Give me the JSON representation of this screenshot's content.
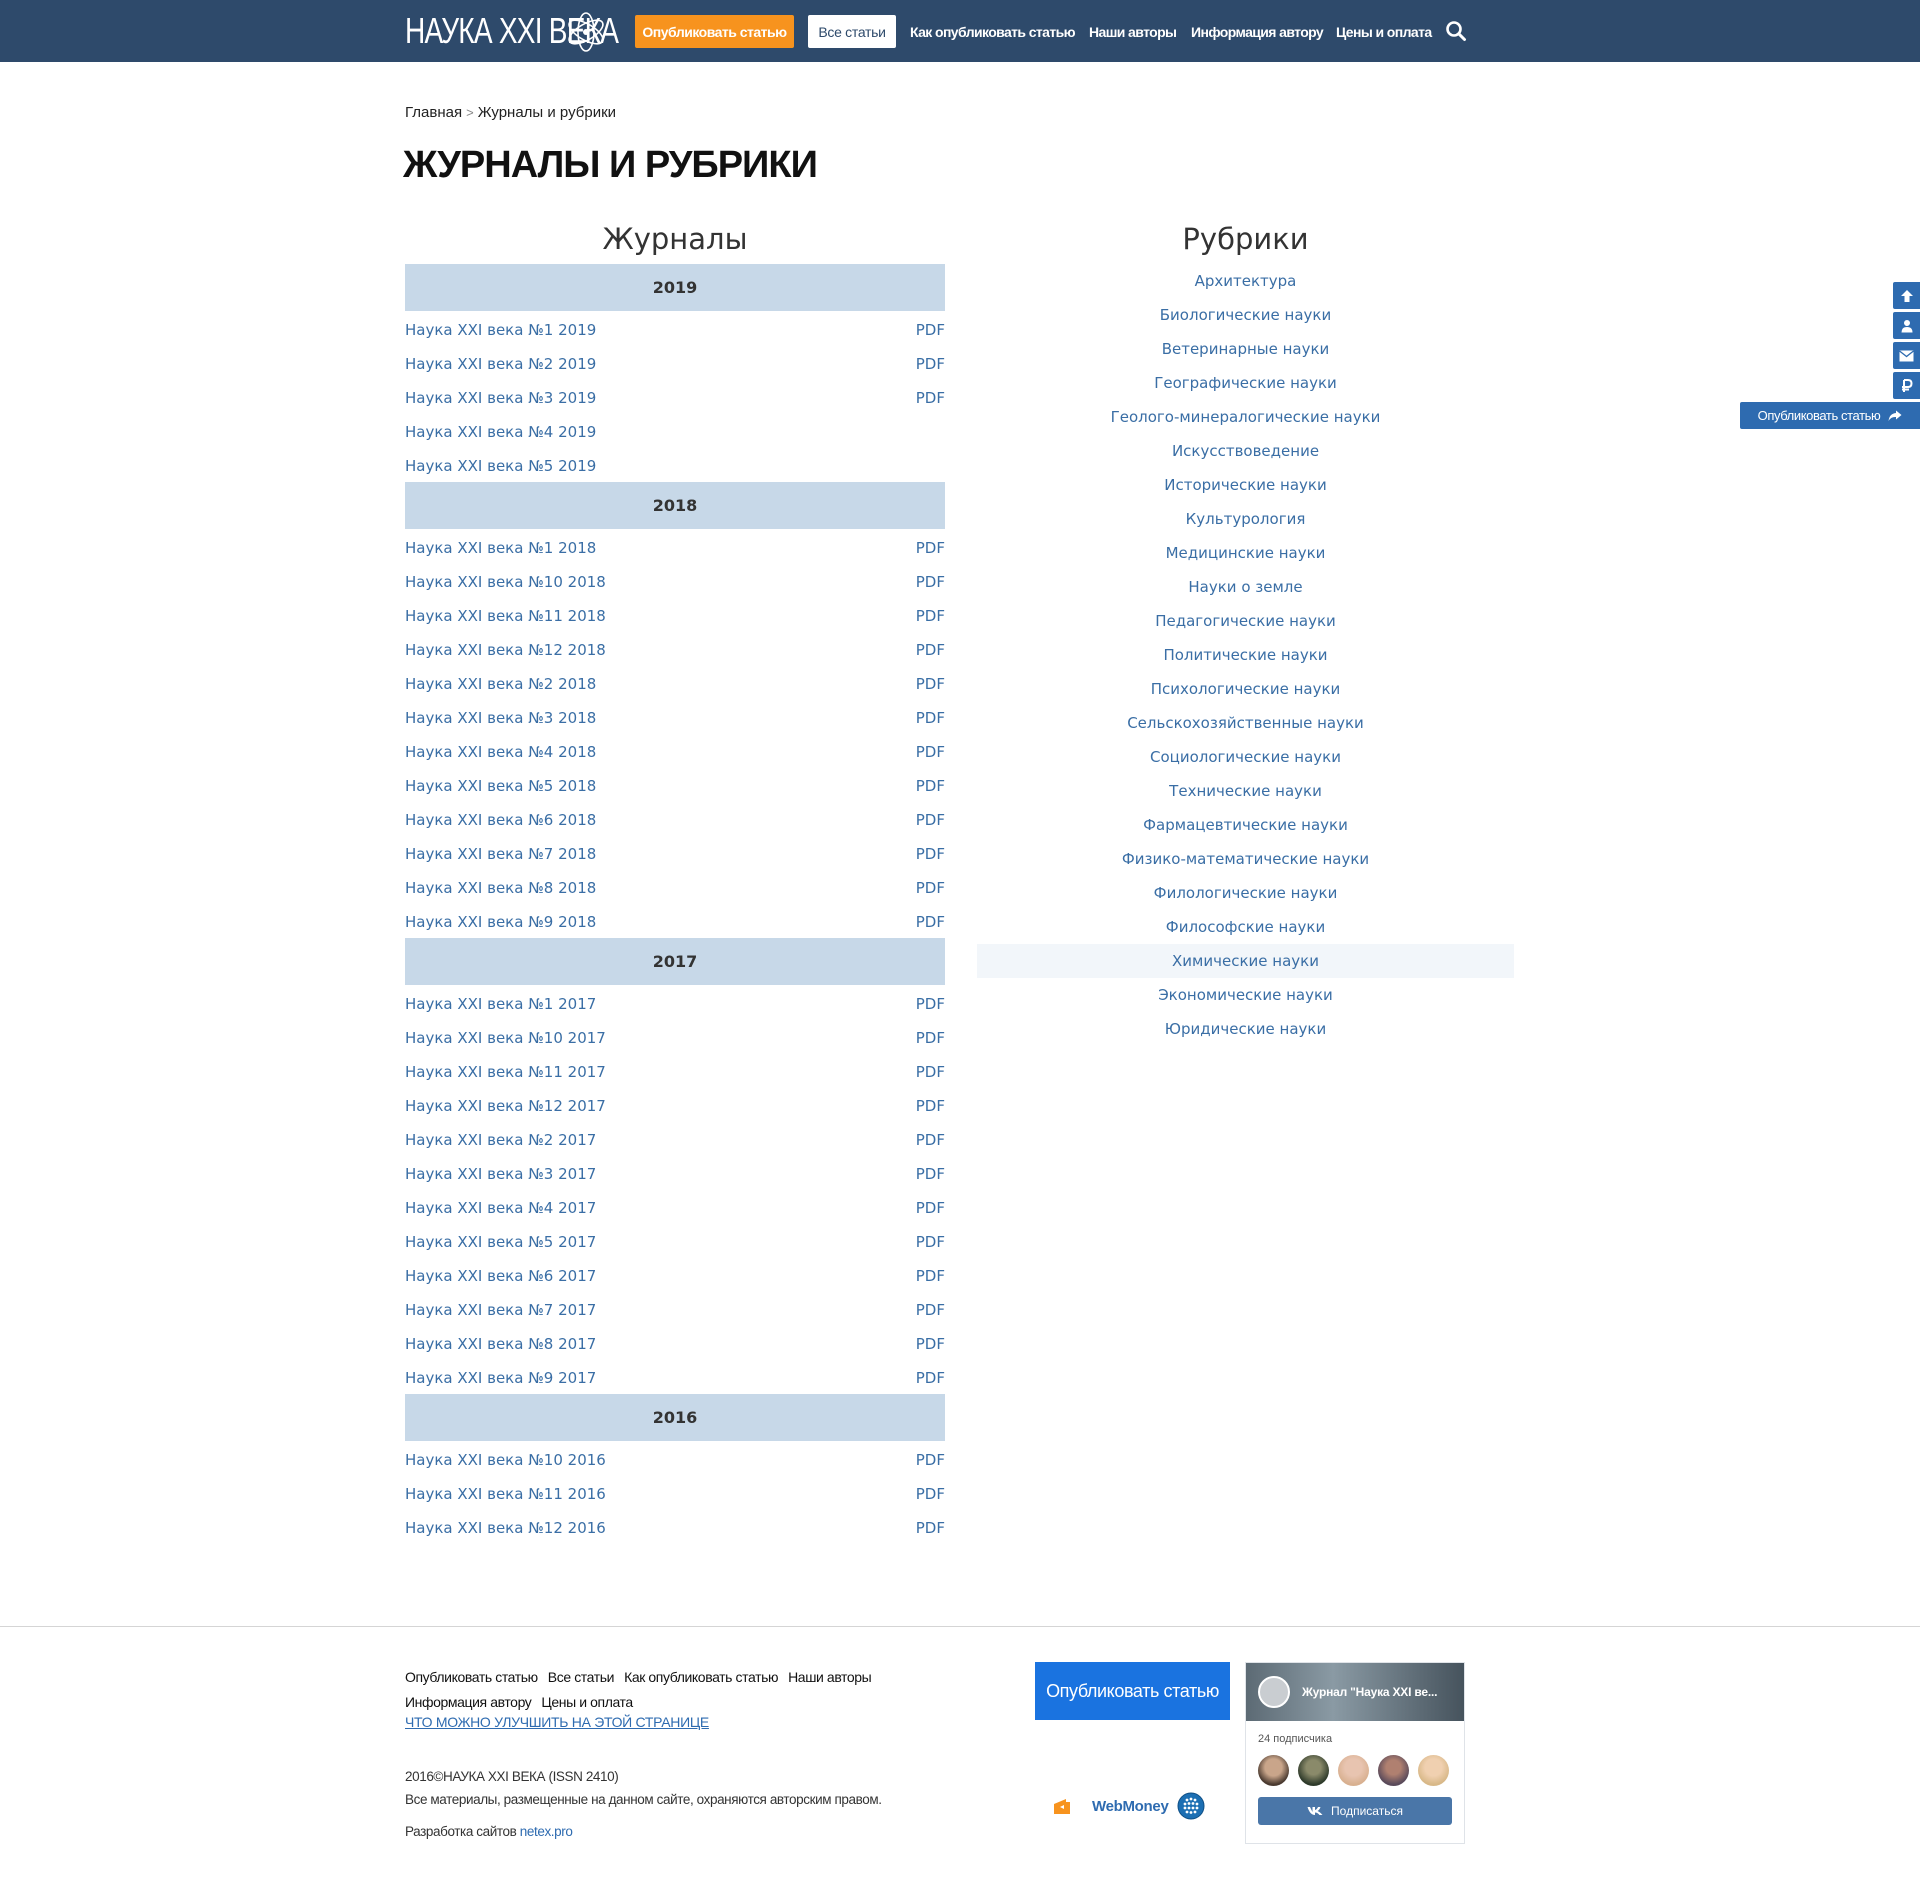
{
  "header": {
    "logo_text": "НАУКА XXI ВЕКА",
    "publish_label": "Опубликовать статью",
    "all_articles_label": "Все статьи",
    "nav": [
      {
        "label": "Как опубликовать статью"
      },
      {
        "label": "Наши авторы"
      },
      {
        "label": "Информация автору"
      },
      {
        "label": "Цены и оплата"
      }
    ],
    "search_icon": "search-icon"
  },
  "breadcrumb": {
    "home": "Главная",
    "separator": ">",
    "current": "Журналы и рубрики"
  },
  "page_title": "ЖУРНАЛЫ И РУБРИКИ",
  "journals": {
    "heading": "Журналы",
    "years": [
      {
        "year": "2019",
        "issues": [
          {
            "title": "Наука XXI века №1 2019",
            "pdf": "PDF"
          },
          {
            "title": "Наука XXI века №2 2019",
            "pdf": "PDF"
          },
          {
            "title": "Наука XXI века №3 2019",
            "pdf": "PDF"
          },
          {
            "title": "Наука XXI века №4 2019",
            "pdf": ""
          },
          {
            "title": "Наука XXI века №5 2019",
            "pdf": ""
          }
        ]
      },
      {
        "year": "2018",
        "issues": [
          {
            "title": "Наука XXI века №1 2018",
            "pdf": "PDF"
          },
          {
            "title": "Наука XXI века №10 2018",
            "pdf": "PDF"
          },
          {
            "title": "Наука XXI века №11 2018",
            "pdf": "PDF"
          },
          {
            "title": "Наука XXI века №12 2018",
            "pdf": "PDF"
          },
          {
            "title": "Наука XXI века №2 2018",
            "pdf": "PDF"
          },
          {
            "title": "Наука XXI века №3 2018",
            "pdf": "PDF"
          },
          {
            "title": "Наука XXI века №4 2018",
            "pdf": "PDF"
          },
          {
            "title": "Наука XXI века №5 2018",
            "pdf": "PDF"
          },
          {
            "title": "Наука XXI века №6 2018",
            "pdf": "PDF"
          },
          {
            "title": "Наука XXI века №7 2018",
            "pdf": "PDF"
          },
          {
            "title": "Наука XXI века №8 2018",
            "pdf": "PDF"
          },
          {
            "title": "Наука XXI века №9 2018",
            "pdf": "PDF"
          }
        ]
      },
      {
        "year": "2017",
        "issues": [
          {
            "title": "Наука XXI века №1 2017",
            "pdf": "PDF"
          },
          {
            "title": "Наука XXI века №10 2017",
            "pdf": "PDF"
          },
          {
            "title": "Наука XXI века №11 2017",
            "pdf": "PDF"
          },
          {
            "title": "Наука XXI века №12 2017",
            "pdf": "PDF"
          },
          {
            "title": "Наука XXI века №2 2017",
            "pdf": "PDF"
          },
          {
            "title": "Наука XXI века №3 2017",
            "pdf": "PDF"
          },
          {
            "title": "Наука XXI века №4 2017",
            "pdf": "PDF"
          },
          {
            "title": "Наука XXI века №5 2017",
            "pdf": "PDF"
          },
          {
            "title": "Наука XXI века №6 2017",
            "pdf": "PDF"
          },
          {
            "title": "Наука XXI века №7 2017",
            "pdf": "PDF"
          },
          {
            "title": "Наука XXI века №8 2017",
            "pdf": "PDF"
          },
          {
            "title": "Наука XXI века №9 2017",
            "pdf": "PDF"
          }
        ]
      },
      {
        "year": "2016",
        "issues": [
          {
            "title": "Наука XXI века №10 2016",
            "pdf": "PDF"
          },
          {
            "title": "Наука XXI века №11 2016",
            "pdf": "PDF"
          },
          {
            "title": "Наука XXI века №12 2016",
            "pdf": "PDF"
          }
        ]
      }
    ]
  },
  "rubrics": {
    "heading": "Рубрики",
    "active": "Химические науки",
    "items": [
      "Архитектура",
      "Биологические науки",
      "Ветеринарные науки",
      "Географические науки",
      "Геолого-минералогические науки",
      "Искусствоведение",
      "Исторические науки",
      "Культурология",
      "Медицинские науки",
      "Науки о земле",
      "Педагогические науки",
      "Политические науки",
      "Психологические науки",
      "Сельскохозяйственные науки",
      "Социологические науки",
      "Технические науки",
      "Фармацевтические науки",
      "Физико-математические науки",
      "Филологические науки",
      "Философские науки",
      "Химические науки",
      "Экономические науки",
      "Юридические науки"
    ]
  },
  "side": {
    "icons": [
      "arrow-up-icon",
      "user-icon",
      "mail-icon",
      "ruble-icon"
    ],
    "publish_label": "Опубликовать статью"
  },
  "footer": {
    "nav": [
      "Опубликовать статью",
      "Все статьи",
      "Как опубликовать статью",
      "Наши авторы",
      "Информация автору",
      "Цены и оплата"
    ],
    "improve_link": "ЧТО МОЖНО УЛУЧШИТЬ НА ЭТОЙ СТРАНИЦЕ",
    "copyright": "2016©НАУКА XXI ВЕКА (ISSN 2410)",
    "rights": "Все материалы, размещенные на данном сайте, охраняются авторским правом.",
    "dev_prefix": "Разработка сайтов",
    "dev_link": "netex.pro",
    "publish_button": "Опубликовать статью",
    "webmoney": "WebMoney"
  },
  "vk": {
    "group_name": "Журнал \"Наука XXI ве...",
    "subscribers": "24 подписчика",
    "subscribe_label": "Подписаться"
  },
  "colors": {
    "header_bg": "#2e4a6b",
    "accent_orange": "#f7931e",
    "link_blue": "#3a6ea5",
    "year_bg": "#c7d8e8",
    "side_blue": "#2e6bb0",
    "footer_button": "#1a73e0",
    "vk_blue": "#4a76a8"
  }
}
